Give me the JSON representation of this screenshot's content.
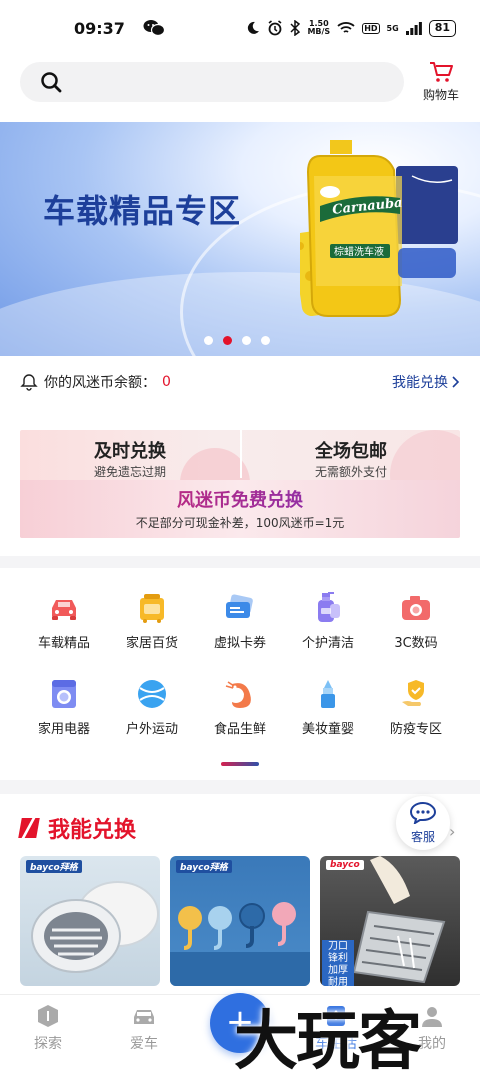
{
  "status_bar": {
    "time": "09:37",
    "net_speed_value": "1.50",
    "net_speed_unit": "MB/S",
    "battery": "81",
    "hd": "HD",
    "network": "5G"
  },
  "header": {
    "cart_label": "购物车"
  },
  "banner": {
    "title": "车载精品专区",
    "product_brand": "Carnauba",
    "product_name": "棕蜡洗车液",
    "dots": 4,
    "active_dot": 1
  },
  "balance": {
    "label": "你的风迷币余额：",
    "value": "0",
    "link": "我能兑换"
  },
  "promo": {
    "left_title": "及时兑换",
    "left_sub": "避免遗忘过期",
    "right_title": "全场包邮",
    "right_sub": "无需额外支付",
    "main_title": "风迷币免费兑换",
    "main_note": "不足部分可现金补差，100风迷币=1元"
  },
  "categories": [
    {
      "label": "车载精品",
      "icon": "car-icon"
    },
    {
      "label": "家居百货",
      "icon": "household-icon"
    },
    {
      "label": "虚拟卡券",
      "icon": "coupon-icon"
    },
    {
      "label": "个护清洁",
      "icon": "cleaning-icon"
    },
    {
      "label": "3C数码",
      "icon": "camera-icon"
    },
    {
      "label": "家用电器",
      "icon": "washer-icon"
    },
    {
      "label": "户外运动",
      "icon": "ball-icon"
    },
    {
      "label": "食品生鲜",
      "icon": "shrimp-icon"
    },
    {
      "label": "美妆童婴",
      "icon": "lipstick-icon"
    },
    {
      "label": "防疫专区",
      "icon": "hand-shield-icon"
    }
  ],
  "section": {
    "title": "我能兑换",
    "service_label": "客服"
  },
  "products": [
    {
      "brand": "bayco拜格",
      "tag": ""
    },
    {
      "brand": "bayco拜格",
      "tag": ""
    },
    {
      "brand": "bayco",
      "tag": "刀口锋利 加厚 耐用"
    }
  ],
  "nav": [
    {
      "label": "探索",
      "icon": "explore-icon"
    },
    {
      "label": "爱车",
      "icon": "car-nav-icon"
    },
    {
      "label": "",
      "icon": "plus-icon"
    },
    {
      "label": "车生活",
      "icon": "car-life-icon"
    },
    {
      "label": "我的",
      "icon": "profile-icon"
    }
  ],
  "plus_symbol": "+",
  "watermark": "大玩客",
  "colors": {
    "accent_red": "#e3132b",
    "brand_blue": "#1d3f9a",
    "nav_active": "#2f6fe0"
  }
}
